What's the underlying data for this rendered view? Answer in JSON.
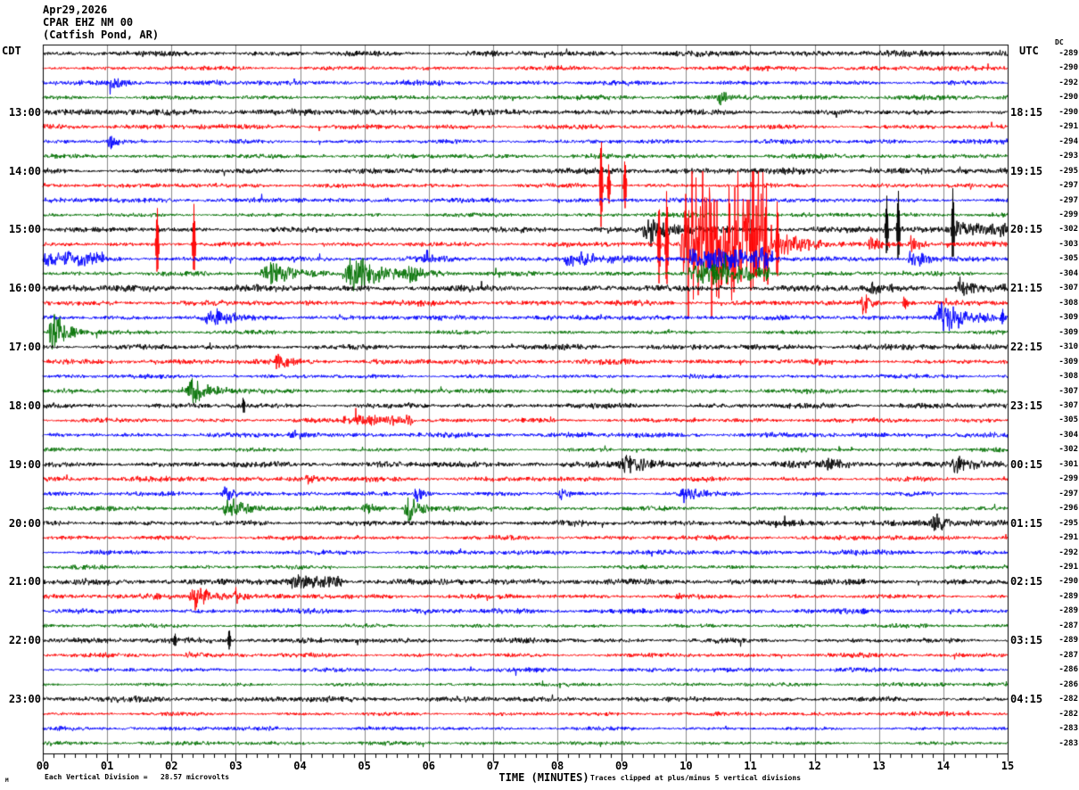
{
  "header": {
    "date": "Apr29,2026",
    "station": "CPAR EHZ NM 00",
    "location": "(Catfish Pond, AR)"
  },
  "axes": {
    "left_timezone": "CDT",
    "right_timezone": "UTC",
    "dc_header": "DC",
    "x_title": "TIME (MINUTES)"
  },
  "footer": {
    "scale_note": "Each Vertical Division =   28.57 microvolts",
    "clip_note": "Traces clipped at plus/minus 5 vertical divisions",
    "logo_mark": "M"
  },
  "chart_data": {
    "type": "line",
    "subtype": "helicorder-seismogram",
    "title": "CPAR EHZ NM 00 (Catfish Pond, AR) Apr29,2026",
    "xlabel": "TIME (MINUTES)",
    "x_range_minutes": [
      0,
      15
    ],
    "x_tick_labels": [
      "00",
      "01",
      "02",
      "03",
      "04",
      "05",
      "06",
      "07",
      "08",
      "09",
      "10",
      "11",
      "12",
      "13",
      "14",
      "15"
    ],
    "minor_tick_intervals_per_minute": 6,
    "minutes_per_line": 15,
    "division_microvolts": 28.57,
    "clip_divisions": 5,
    "grid": true,
    "grid_color": "#8a8a8a",
    "colors": {
      "black": "#000000",
      "red": "#ff0000",
      "blue": "#0000ff",
      "green": "#007000"
    },
    "default_amp": {
      "black": 4.1,
      "red": 3.5,
      "blue": 3.3,
      "green": 3.1
    },
    "rows": [
      {
        "color": "black",
        "left": "",
        "right": "",
        "dc": "-289",
        "namp": 4.4,
        "events": []
      },
      {
        "color": "red",
        "left": "",
        "right": "",
        "dc": "-290",
        "events": []
      },
      {
        "color": "blue",
        "left": "",
        "right": "",
        "dc": "-292",
        "events": [
          {
            "type": "burst",
            "t0": 1.0,
            "t1": 1.5,
            "a": 7
          }
        ]
      },
      {
        "color": "green",
        "left": "",
        "right": "",
        "dc": "-290",
        "events": [
          {
            "type": "burst",
            "t0": 10.45,
            "t1": 10.75,
            "a": 9
          }
        ]
      },
      {
        "color": "black",
        "left": "13:00",
        "right": "18:15",
        "dc": "-290",
        "events": []
      },
      {
        "color": "red",
        "left": "",
        "right": "",
        "dc": "-291",
        "events": []
      },
      {
        "color": "blue",
        "left": "",
        "right": "",
        "dc": "-294",
        "events": [
          {
            "type": "burst",
            "t0": 1.0,
            "t1": 1.25,
            "a": 11
          }
        ]
      },
      {
        "color": "green",
        "left": "",
        "right": "",
        "dc": "-293",
        "events": []
      },
      {
        "color": "black",
        "left": "14:00",
        "right": "19:15",
        "dc": "-295",
        "events": []
      },
      {
        "color": "red",
        "left": "",
        "right": "",
        "dc": "-297",
        "events": [
          {
            "type": "spike",
            "c": 8.68,
            "a": 58
          },
          {
            "type": "spike",
            "c": 8.8,
            "a": 26
          },
          {
            "type": "spike",
            "c": 9.05,
            "a": 32
          }
        ]
      },
      {
        "color": "blue",
        "left": "",
        "right": "",
        "dc": "-297",
        "events": []
      },
      {
        "color": "green",
        "left": "",
        "right": "",
        "dc": "-299",
        "events": []
      },
      {
        "color": "black",
        "left": "15:00",
        "right": "20:15",
        "dc": "-302",
        "namp": 4.4,
        "events": [
          {
            "type": "burst",
            "t0": 9.3,
            "t1": 10.0,
            "a": 22
          },
          {
            "type": "spike",
            "c": 13.12,
            "a": 40
          },
          {
            "type": "spike",
            "c": 13.3,
            "a": 44
          },
          {
            "type": "spike",
            "c": 14.15,
            "a": 50
          },
          {
            "type": "flat",
            "t0": 14.2,
            "t1": 15,
            "a": 7
          }
        ]
      },
      {
        "color": "red",
        "left": "",
        "right": "",
        "dc": "-303",
        "events": [
          {
            "type": "spike",
            "c": 1.78,
            "a": 44
          },
          {
            "type": "spike",
            "c": 2.35,
            "a": 46
          },
          {
            "type": "spike",
            "c": 9.58,
            "a": 50
          },
          {
            "type": "spike",
            "c": 9.7,
            "a": 65
          },
          {
            "type": "clip",
            "t0": 9.9,
            "t1": 11.35,
            "a": 125
          },
          {
            "type": "spike",
            "c": 11.42,
            "a": 55
          },
          {
            "type": "burst",
            "t0": 11.35,
            "t1": 12.3,
            "a": 12
          },
          {
            "type": "burst",
            "t0": 12.8,
            "t1": 13.15,
            "a": 9
          },
          {
            "type": "burst",
            "t0": 13.45,
            "t1": 13.7,
            "a": 13
          }
        ]
      },
      {
        "color": "blue",
        "left": "",
        "right": "",
        "dc": "-305",
        "events": [
          {
            "type": "flat",
            "t0": 0.0,
            "t1": 0.9,
            "a": 6
          },
          {
            "type": "burst",
            "t0": 5.9,
            "t1": 6.2,
            "a": 10
          },
          {
            "type": "burst",
            "t0": 8.05,
            "t1": 8.95,
            "a": 12
          },
          {
            "type": "flat",
            "t0": 10.1,
            "t1": 11.3,
            "a": 12
          },
          {
            "type": "burst",
            "t0": 13.4,
            "t1": 14.0,
            "a": 13
          }
        ]
      },
      {
        "color": "green",
        "left": "",
        "right": "",
        "dc": "-304",
        "events": [
          {
            "type": "burst",
            "t0": 3.35,
            "t1": 4.25,
            "a": 15
          },
          {
            "type": "burst",
            "t0": 4.65,
            "t1": 5.6,
            "a": 25
          },
          {
            "type": "burst",
            "t0": 5.6,
            "t1": 6.1,
            "a": 12
          },
          {
            "type": "flat",
            "t0": 10.1,
            "t1": 10.6,
            "a": 11
          },
          {
            "type": "flat",
            "t0": 10.6,
            "t1": 11.25,
            "a": 6
          }
        ]
      },
      {
        "color": "black",
        "left": "16:00",
        "right": "21:15",
        "dc": "-307",
        "namp": 5.0,
        "events": [
          {
            "type": "burst",
            "t0": 12.8,
            "t1": 13.25,
            "a": 8
          },
          {
            "type": "burst",
            "t0": 14.15,
            "t1": 14.75,
            "a": 10
          }
        ]
      },
      {
        "color": "red",
        "left": "",
        "right": "",
        "dc": "-308",
        "events": [
          {
            "type": "burst",
            "t0": 12.7,
            "t1": 12.95,
            "a": 15
          },
          {
            "type": "burst",
            "t0": 13.35,
            "t1": 13.55,
            "a": 8
          }
        ]
      },
      {
        "color": "blue",
        "left": "",
        "right": "",
        "dc": "-309",
        "events": [
          {
            "type": "burst",
            "t0": 2.45,
            "t1": 3.15,
            "a": 12
          },
          {
            "type": "burst",
            "t0": 13.85,
            "t1": 14.55,
            "a": 25
          },
          {
            "type": "spike",
            "c": 14.92,
            "a": 10
          }
        ]
      },
      {
        "color": "green",
        "left": "",
        "right": "",
        "dc": "-309",
        "events": [
          {
            "type": "burst",
            "t0": 0.05,
            "t1": 0.6,
            "a": 26
          }
        ]
      },
      {
        "color": "black",
        "left": "17:00",
        "right": "22:15",
        "dc": "-310",
        "namp": 4.2,
        "events": []
      },
      {
        "color": "red",
        "left": "",
        "right": "",
        "dc": "-309",
        "events": [
          {
            "type": "burst",
            "t0": 3.6,
            "t1": 3.95,
            "a": 13
          }
        ]
      },
      {
        "color": "blue",
        "left": "",
        "right": "",
        "dc": "-308",
        "events": []
      },
      {
        "color": "green",
        "left": "",
        "right": "",
        "dc": "-307",
        "events": [
          {
            "type": "burst",
            "t0": 2.2,
            "t1": 2.85,
            "a": 19
          }
        ]
      },
      {
        "color": "black",
        "left": "18:00",
        "right": "23:15",
        "dc": "-307",
        "events": [
          {
            "type": "spike",
            "c": 3.12,
            "a": 10
          }
        ]
      },
      {
        "color": "red",
        "left": "",
        "right": "",
        "dc": "-305",
        "events": [
          {
            "type": "flat",
            "t0": 4.7,
            "t1": 5.7,
            "a": 5
          }
        ]
      },
      {
        "color": "blue",
        "left": "",
        "right": "",
        "dc": "-304",
        "events": [
          {
            "type": "burst",
            "t0": 3.8,
            "t1": 4.3,
            "a": 6
          }
        ]
      },
      {
        "color": "green",
        "left": "",
        "right": "",
        "dc": "-302",
        "events": []
      },
      {
        "color": "black",
        "left": "19:00",
        "right": "00:15",
        "dc": "-301",
        "events": [
          {
            "type": "burst",
            "t0": 8.95,
            "t1": 9.7,
            "a": 13
          },
          {
            "type": "burst",
            "t0": 12.1,
            "t1": 12.6,
            "a": 8
          },
          {
            "type": "burst",
            "t0": 14.1,
            "t1": 14.6,
            "a": 12
          }
        ]
      },
      {
        "color": "red",
        "left": "",
        "right": "",
        "dc": "-299",
        "events": [
          {
            "type": "burst",
            "t0": 4.05,
            "t1": 4.3,
            "a": 8
          }
        ]
      },
      {
        "color": "blue",
        "left": "",
        "right": "",
        "dc": "-297",
        "events": [
          {
            "type": "burst",
            "t0": 2.75,
            "t1": 3.15,
            "a": 10
          },
          {
            "type": "burst",
            "t0": 5.75,
            "t1": 6.05,
            "a": 11
          },
          {
            "type": "burst",
            "t0": 8.0,
            "t1": 8.3,
            "a": 7
          },
          {
            "type": "burst",
            "t0": 9.85,
            "t1": 10.4,
            "a": 9
          }
        ]
      },
      {
        "color": "green",
        "left": "",
        "right": "",
        "dc": "-296",
        "events": [
          {
            "type": "burst",
            "t0": 2.75,
            "t1": 3.4,
            "a": 12
          },
          {
            "type": "burst",
            "t0": 4.95,
            "t1": 5.3,
            "a": 12
          },
          {
            "type": "burst",
            "t0": 5.6,
            "t1": 6.05,
            "a": 16
          }
        ]
      },
      {
        "color": "black",
        "left": "20:00",
        "right": "01:15",
        "dc": "-295",
        "events": [
          {
            "type": "burst",
            "t0": 13.8,
            "t1": 14.15,
            "a": 13
          }
        ]
      },
      {
        "color": "red",
        "left": "",
        "right": "",
        "dc": "-291",
        "events": []
      },
      {
        "color": "blue",
        "left": "",
        "right": "",
        "dc": "-292",
        "events": []
      },
      {
        "color": "green",
        "left": "",
        "right": "",
        "dc": "-291",
        "events": []
      },
      {
        "color": "black",
        "left": "21:00",
        "right": "02:15",
        "dc": "-290",
        "events": [
          {
            "type": "flat",
            "t0": 3.9,
            "t1": 4.6,
            "a": 5
          }
        ]
      },
      {
        "color": "red",
        "left": "",
        "right": "",
        "dc": "-289",
        "events": [
          {
            "type": "burst",
            "t0": 2.25,
            "t1": 2.85,
            "a": 16
          },
          {
            "type": "burst",
            "t0": 2.95,
            "t1": 3.15,
            "a": 9
          }
        ]
      },
      {
        "color": "blue",
        "left": "",
        "right": "",
        "dc": "-289",
        "events": []
      },
      {
        "color": "green",
        "left": "",
        "right": "",
        "dc": "-287",
        "events": []
      },
      {
        "color": "black",
        "left": "22:00",
        "right": "03:15",
        "dc": "-289",
        "namp": 3.8,
        "events": [
          {
            "type": "spike",
            "c": 2.06,
            "a": 10
          },
          {
            "type": "spike",
            "c": 2.9,
            "a": 13
          }
        ]
      },
      {
        "color": "red",
        "left": "",
        "right": "",
        "dc": "-287",
        "events": [
          {
            "type": "burst",
            "t0": 2.2,
            "t1": 2.6,
            "a": 6
          }
        ]
      },
      {
        "color": "blue",
        "left": "",
        "right": "",
        "dc": "-286",
        "namp": 2.9,
        "events": []
      },
      {
        "color": "green",
        "left": "",
        "right": "",
        "dc": "-286",
        "namp": 2.7,
        "events": []
      },
      {
        "color": "black",
        "left": "23:00",
        "right": "04:15",
        "dc": "-282",
        "namp": 3.7,
        "events": []
      },
      {
        "color": "red",
        "left": "",
        "right": "",
        "dc": "-282",
        "namp": 2.9,
        "events": []
      },
      {
        "color": "blue",
        "left": "",
        "right": "",
        "dc": "-283",
        "namp": 2.8,
        "events": []
      },
      {
        "color": "green",
        "left": "",
        "right": "",
        "dc": "-283",
        "namp": 2.6,
        "events": []
      }
    ]
  }
}
